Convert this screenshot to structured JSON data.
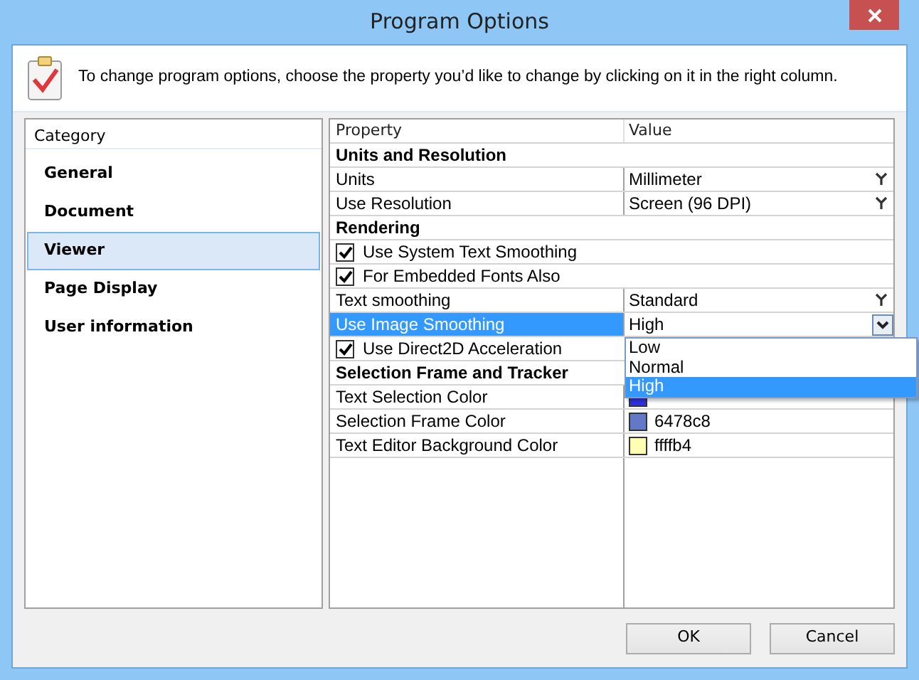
{
  "window": {
    "title": "Program Options"
  },
  "header": {
    "text": "To change program options, choose the property you’d like to change by clicking on it in the right column."
  },
  "categories": {
    "heading": "Category",
    "items": [
      {
        "label": "General",
        "selected": false
      },
      {
        "label": "Document",
        "selected": false
      },
      {
        "label": "Viewer",
        "selected": true
      },
      {
        "label": "Page Display",
        "selected": false
      },
      {
        "label": "User information",
        "selected": false
      }
    ]
  },
  "grid": {
    "columns": [
      "Property",
      "Value"
    ],
    "rows": [
      {
        "kind": "section",
        "label": "Units and Resolution"
      },
      {
        "kind": "dropdown",
        "label": "Units",
        "value": "Millimeter",
        "selected": false
      },
      {
        "kind": "dropdown",
        "label": "Use Resolution",
        "value": "Screen (96 DPI)",
        "selected": false
      },
      {
        "kind": "section",
        "label": "Rendering"
      },
      {
        "kind": "check",
        "label": "Use System Text Smoothing",
        "checked": true
      },
      {
        "kind": "check",
        "label": "For Embedded Fonts Also",
        "checked": true
      },
      {
        "kind": "dropdown",
        "label": "Text smoothing",
        "value": "Standard",
        "selected": false
      },
      {
        "kind": "dropdown",
        "label": "Use Image Smoothing",
        "value": "High",
        "selected": true,
        "expanded": true,
        "options": [
          {
            "label": "Low",
            "selected": false
          },
          {
            "label": "Normal",
            "selected": false
          },
          {
            "label": "High",
            "selected": true
          }
        ]
      },
      {
        "kind": "check",
        "label": "Use Direct2D Acceleration",
        "checked": true
      },
      {
        "kind": "section",
        "label": "Selection Frame and Tracker"
      },
      {
        "kind": "color",
        "label": "Text Selection Color",
        "color": "#3030e0",
        "selected": false
      },
      {
        "kind": "color",
        "label": "Selection Frame Color",
        "value": "6478c8",
        "color": "#6478c8",
        "selected": false
      },
      {
        "kind": "color",
        "label": "Text Editor Background Color",
        "value": "ffffb4",
        "color": "#ffffb4",
        "selected": false
      }
    ]
  },
  "buttons": [
    "OK",
    "Cancel"
  ]
}
